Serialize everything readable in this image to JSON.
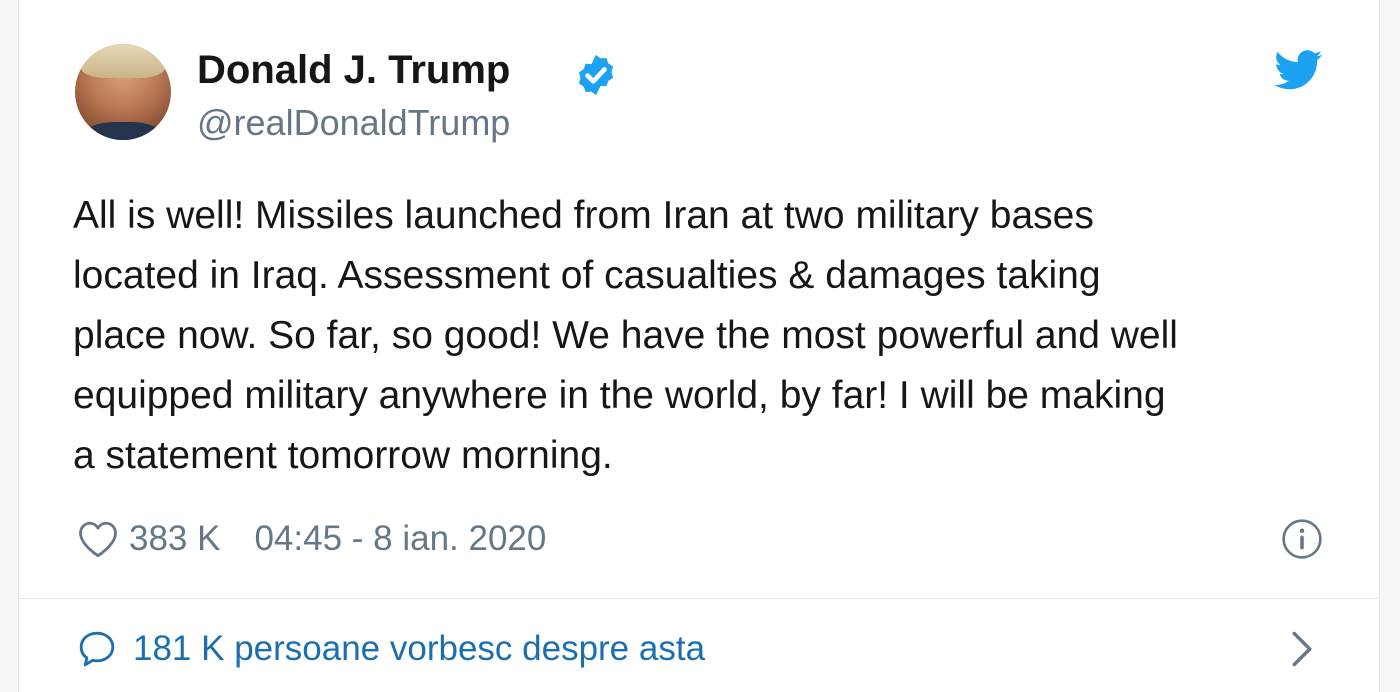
{
  "tweet": {
    "author": {
      "name": "Donald J. Trump",
      "handle": "@realDonaldTrump",
      "verified": true
    },
    "text_lines": [
      "All is well! Missiles launched from Iran at two military bases",
      "located in Iraq. Assessment of casualties & damages taking",
      "place now. So far, so good! We have the most powerful and well",
      "equipped military anywhere in the world, by far! I will be making",
      "a statement tomorrow morning."
    ],
    "likes": "383 K",
    "timestamp": "04:45 - 8 ian. 2020",
    "conversation": "181 K persoane vorbesc despre asta"
  },
  "icons": {
    "verified": "verified-badge-icon",
    "brand": "twitter-bird-icon",
    "like": "heart-icon",
    "info": "info-icon",
    "reply": "speech-bubble-icon",
    "chevron": "chevron-right-icon"
  },
  "colors": {
    "brand_blue": "#1da1f2",
    "text": "#14171a",
    "muted": "#657786",
    "link": "#1b6fb1"
  }
}
